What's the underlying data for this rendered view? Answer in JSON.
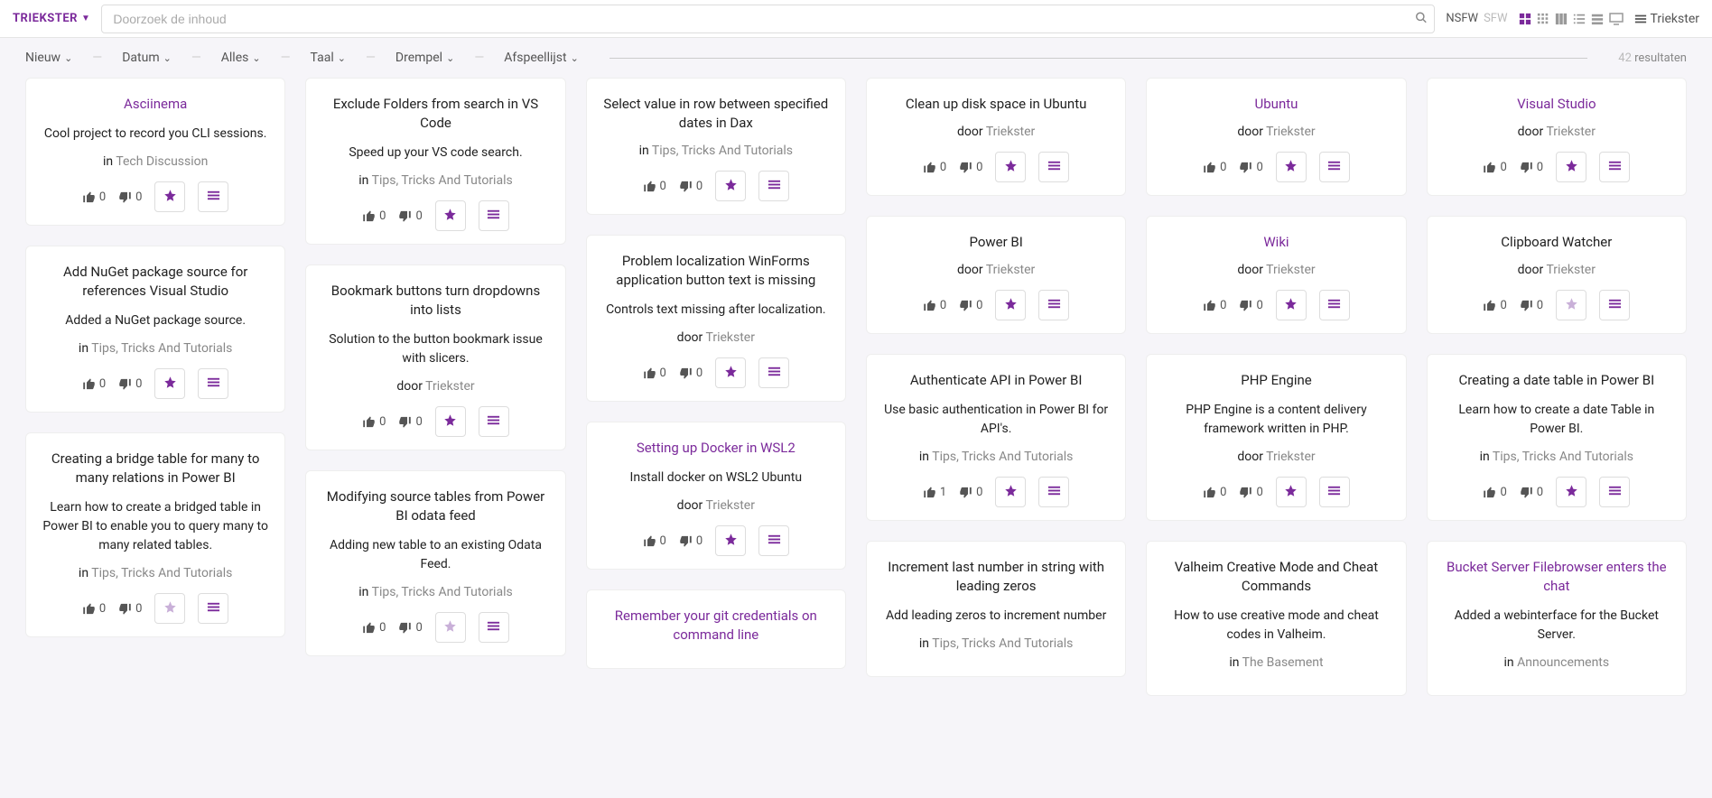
{
  "header": {
    "brand": "TRIEKSTER",
    "search_placeholder": "Doorzoek de inhoud",
    "nsfw": "NSFW",
    "sfw": "SFW",
    "user": "Triekster"
  },
  "filters": {
    "items": [
      "Nieuw",
      "Datum",
      "Alles",
      "Taal",
      "Drempel",
      "Afspeellijst"
    ],
    "count": "42",
    "label": "resultaten"
  },
  "cols": [
    [
      {
        "title": "Asciinema",
        "desc": "Cool project to record you CLI sessions.",
        "meta_prefix": "in",
        "meta_link": "Tech Discussion",
        "up": "0",
        "down": "0",
        "star_dim": false
      },
      {
        "title": "Add NuGet package source for references Visual Studio",
        "title_plain": true,
        "desc": "Added a NuGet package source.",
        "meta_prefix": "in",
        "meta_link": "Tips, Tricks And Tutorials",
        "up": "0",
        "down": "0",
        "star_dim": false
      },
      {
        "title": "Creating a bridge table for many to many relations in Power BI",
        "title_plain": true,
        "desc": "Learn how to create a bridged table in Power BI to enable you to query many to many related tables.",
        "meta_prefix": "in",
        "meta_link": "Tips, Tricks And Tutorials",
        "up": "0",
        "down": "0",
        "star_dim": true
      }
    ],
    [
      {
        "title": "Exclude Folders from search in VS Code",
        "title_plain": true,
        "desc": "Speed up your VS code search.",
        "meta_prefix": "in",
        "meta_link": "Tips, Tricks And Tutorials",
        "up": "0",
        "down": "0",
        "star_dim": false
      },
      {
        "title": "Bookmark buttons turn dropdowns into lists",
        "title_plain": true,
        "desc": "Solution to the button bookmark issue with slicers.",
        "meta_prefix": "door",
        "meta_link": "Triekster",
        "up": "0",
        "down": "0",
        "star_dim": false
      },
      {
        "title": "Modifying source tables from Power BI odata feed",
        "title_plain": true,
        "desc": "Adding new table to an existing Odata Feed.",
        "meta_prefix": "in",
        "meta_link": "Tips, Tricks And Tutorials",
        "up": "0",
        "down": "0",
        "star_dim": true
      }
    ],
    [
      {
        "title": "Select value in row between specified dates in Dax",
        "title_plain": true,
        "desc": "",
        "meta_prefix": "in",
        "meta_link": "Tips, Tricks And Tutorials",
        "up": "0",
        "down": "0",
        "star_dim": false
      },
      {
        "title": "Problem localization WinForms application button text is missing",
        "title_plain": true,
        "desc": "Controls text missing after localization.",
        "meta_prefix": "door",
        "meta_link": "Triekster",
        "up": "0",
        "down": "0",
        "star_dim": false
      },
      {
        "title": "Setting up Docker in WSL2",
        "desc": "Install docker on WSL2 Ubuntu",
        "meta_prefix": "door",
        "meta_link": "Triekster",
        "up": "0",
        "down": "0",
        "star_dim": false
      },
      {
        "title": "Remember your git credentials on command line",
        "no_actions": true
      }
    ],
    [
      {
        "title": "Clean up disk space in Ubuntu",
        "title_plain": true,
        "desc": "",
        "meta_prefix": "door",
        "meta_link": "Triekster",
        "up": "0",
        "down": "0",
        "star_dim": false
      },
      {
        "title": "Power BI",
        "title_plain": true,
        "desc": "",
        "meta_prefix": "door",
        "meta_link": "Triekster",
        "up": "0",
        "down": "0",
        "star_dim": false
      },
      {
        "title": "Authenticate API in Power BI",
        "title_plain": true,
        "desc": "Use basic authentication in Power BI for API's.",
        "meta_prefix": "in",
        "meta_link": "Tips, Tricks And Tutorials",
        "up": "1",
        "down": "0",
        "star_dim": false
      },
      {
        "title": "Increment last number in string with leading zeros",
        "title_plain": true,
        "desc": "Add leading zeros to increment number",
        "meta_prefix": "in",
        "meta_link": "Tips, Tricks And Tutorials",
        "no_actions": true
      }
    ],
    [
      {
        "title": "Ubuntu",
        "desc": "",
        "meta_prefix": "door",
        "meta_link": "Triekster",
        "up": "0",
        "down": "0",
        "star_dim": false
      },
      {
        "title": "Wiki",
        "desc": "",
        "meta_prefix": "door",
        "meta_link": "Triekster",
        "up": "0",
        "down": "0",
        "star_dim": false
      },
      {
        "title": "PHP Engine",
        "title_plain": true,
        "desc": "PHP Engine is a content delivery framework written in PHP.",
        "meta_prefix": "door",
        "meta_link": "Triekster",
        "up": "0",
        "down": "0",
        "star_dim": false
      },
      {
        "title": "Valheim Creative Mode and Cheat Commands",
        "title_plain": true,
        "desc": "How to use creative mode and cheat codes in Valheim.",
        "meta_prefix": "in",
        "meta_link": "The Basement",
        "no_actions": true
      }
    ],
    [
      {
        "title": "Visual Studio",
        "desc": "",
        "meta_prefix": "door",
        "meta_link": "Triekster",
        "up": "0",
        "down": "0",
        "star_dim": false
      },
      {
        "title": "Clipboard Watcher",
        "title_plain": true,
        "desc": "",
        "meta_prefix": "door",
        "meta_link": "Triekster",
        "up": "0",
        "down": "0",
        "star_dim": true
      },
      {
        "title": "Creating a date table in Power BI",
        "title_plain": true,
        "desc": "Learn how to create a date Table in Power BI.",
        "meta_prefix": "in",
        "meta_link": "Tips, Tricks And Tutorials",
        "up": "0",
        "down": "0",
        "star_dim": false
      },
      {
        "title": "Bucket Server Filebrowser enters the chat",
        "desc": "Added a webinterface for the Bucket Server.",
        "meta_prefix": "in",
        "meta_link": "Announcements",
        "no_actions": true
      }
    ]
  ]
}
